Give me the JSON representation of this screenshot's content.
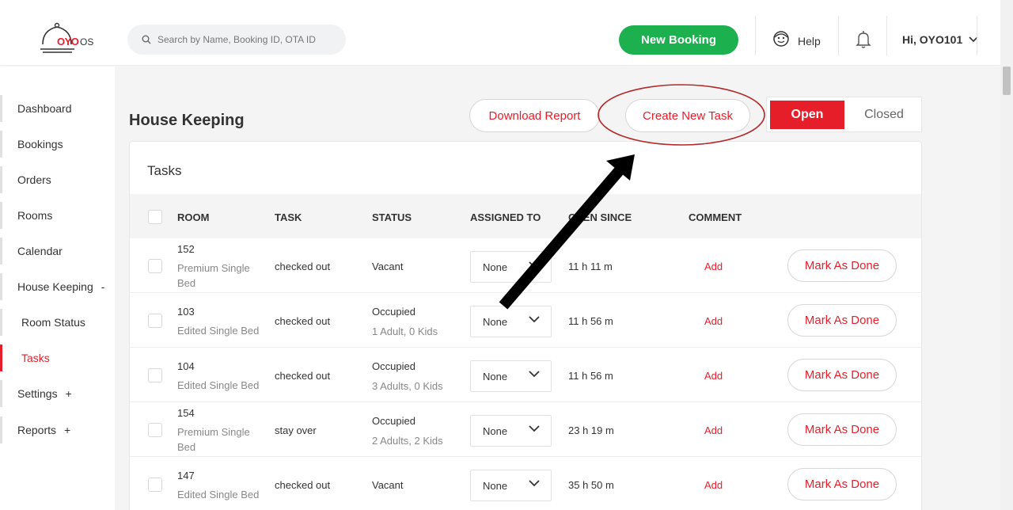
{
  "header": {
    "logo_text": "OYO",
    "logo_suffix": "OS",
    "search_placeholder": "Search by Name, Booking ID, OTA ID",
    "new_booking_label": "New Booking",
    "help_label": "Help",
    "user_label": "Hi, OYO101"
  },
  "sidebar": {
    "items": [
      {
        "label": "Dashboard"
      },
      {
        "label": "Bookings"
      },
      {
        "label": "Orders"
      },
      {
        "label": "Rooms"
      },
      {
        "label": "Calendar"
      },
      {
        "label": "House Keeping",
        "sign": "-"
      },
      {
        "label": "Room Status"
      },
      {
        "label": "Tasks"
      },
      {
        "label": "Settings",
        "sign": "+"
      },
      {
        "label": "Reports",
        "sign": "+"
      }
    ]
  },
  "main": {
    "title": "House Keeping",
    "download_report_label": "Download Report",
    "create_task_label": "Create New Task",
    "toggle_open_label": "Open",
    "toggle_closed_label": "Closed",
    "card_title": "Tasks",
    "columns": [
      "ROOM",
      "TASK",
      "STATUS",
      "ASSIGNED TO",
      "OPEN SINCE",
      "COMMENT"
    ],
    "rows": [
      {
        "room": "152",
        "room_type": "Premium Single Bed",
        "task": "checked out",
        "status": "Vacant",
        "status_detail": "",
        "assigned": "None",
        "since": "11 h 11 m",
        "comment": "Add",
        "action": "Mark As Done"
      },
      {
        "room": "103",
        "room_type": "Edited Single Bed",
        "task": "checked out",
        "status": "Occupied",
        "status_detail": "1 Adult, 0 Kids",
        "assigned": "None",
        "since": "11 h 56 m",
        "comment": "Add",
        "action": "Mark As Done"
      },
      {
        "room": "104",
        "room_type": "Edited Single Bed",
        "task": "checked out",
        "status": "Occupied",
        "status_detail": "3 Adults, 0 Kids",
        "assigned": "None",
        "since": "11 h 56 m",
        "comment": "Add",
        "action": "Mark As Done"
      },
      {
        "room": "154",
        "room_type": "Premium Single Bed",
        "task": "stay over",
        "status": "Occupied",
        "status_detail": "2 Adults, 2 Kids",
        "assigned": "None",
        "since": "23 h 19 m",
        "comment": "Add",
        "action": "Mark As Done"
      },
      {
        "room": "147",
        "room_type": "Edited Single Bed",
        "task": "checked out",
        "status": "Vacant",
        "status_detail": "",
        "assigned": "None",
        "since": "35 h 50 m",
        "comment": "Add",
        "action": "Mark As Done"
      }
    ]
  },
  "colors": {
    "brand_red": "#e61e2a",
    "green": "#1cb04f",
    "annotation": "#b22a2a"
  },
  "icons": [
    "search-icon",
    "help-face-icon",
    "bell-icon",
    "chevron-down-icon"
  ]
}
